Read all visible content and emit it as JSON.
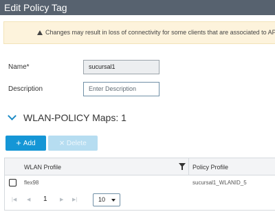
{
  "window": {
    "title": "Edit Policy Tag"
  },
  "warning": {
    "text": "Changes may result in loss of connectivity for some clients that are associated to AP"
  },
  "form": {
    "name_label": "Name*",
    "name_value": "sucursal1",
    "description_label": "Description",
    "description_placeholder": "Enter Description"
  },
  "section": {
    "title": "WLAN-POLICY Maps: 1"
  },
  "toolbar": {
    "add_label": "Add",
    "delete_label": "Delete",
    "add_icon": "+",
    "delete_icon": "×"
  },
  "table": {
    "columns": [
      "WLAN Profile",
      "Policy Profile"
    ],
    "rows": [
      {
        "wlan_profile": "flex98",
        "policy_profile": "sucursal1_WLANID_5"
      }
    ]
  },
  "pagination": {
    "current_page": "1",
    "page_size": "10"
  },
  "colors": {
    "titlebar": "#57626f",
    "accent": "#1596d6",
    "warning_bg": "#fdf3dc"
  }
}
